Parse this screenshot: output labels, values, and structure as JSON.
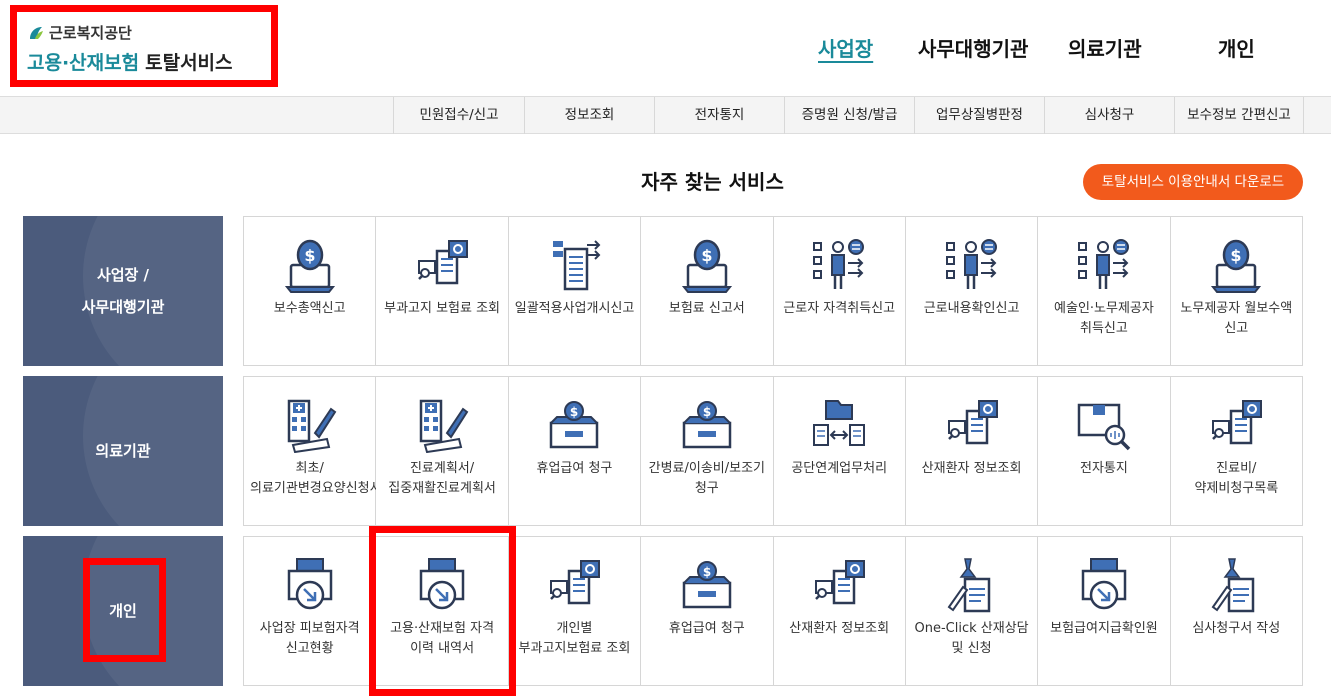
{
  "logo": {
    "org": "근로복지공단",
    "name_part1": "고용·산재보험",
    "name_part2": "토탈서비스"
  },
  "top_nav": [
    {
      "label": "사업장",
      "active": true
    },
    {
      "label": "사무대행기관",
      "active": false
    },
    {
      "label": "의료기관",
      "active": false
    },
    {
      "label": "개인",
      "active": false
    }
  ],
  "sub_nav": [
    {
      "label": "민원접수/신고"
    },
    {
      "label": "정보조회"
    },
    {
      "label": "전자통지"
    },
    {
      "label": "증명원 신청/발급"
    },
    {
      "label": "업무상질병판정"
    },
    {
      "label": "심사청구"
    },
    {
      "label": "보수정보 간편신고"
    }
  ],
  "section": {
    "title": "자주 찾는 서비스",
    "download_label": "토탈서비스 이용안내서 다운로드"
  },
  "rows": [
    {
      "category": "사업장 /\n사무대행기관",
      "tiles": [
        {
          "label": "보수총액신고",
          "icon": "money-laptop-icon"
        },
        {
          "label": "부과고지 보험료 조회",
          "icon": "document-search-icon"
        },
        {
          "label": "일괄적용사업개시신고",
          "icon": "document-transfer-icon"
        },
        {
          "label": "보험료 신고서",
          "icon": "money-laptop-icon"
        },
        {
          "label": "근로자 자격취득신고",
          "icon": "presenter-checklist-icon"
        },
        {
          "label": "근로내용확인신고",
          "icon": "presenter-checklist-icon"
        },
        {
          "label": "예술인·노무제공자 취득신고",
          "icon": "presenter-checklist-icon"
        },
        {
          "label": "노무제공자 월보수액 신고",
          "icon": "money-laptop-icon"
        }
      ]
    },
    {
      "category": "의료기관",
      "tiles": [
        {
          "label": "최초/의료기관변경요양신청서",
          "icon": "hospital-pen-icon"
        },
        {
          "label": "진료계획서/집중재활진료계획서",
          "icon": "hospital-pen-icon"
        },
        {
          "label": "휴업급여 청구",
          "icon": "money-box-icon"
        },
        {
          "label": "간병료/이송비/보조기 청구",
          "icon": "money-box-icon"
        },
        {
          "label": "공단연계업무처리",
          "icon": "folder-exchange-icon"
        },
        {
          "label": "산재환자 정보조회",
          "icon": "document-search-icon"
        },
        {
          "label": "전자통지",
          "icon": "box-magnifier-icon"
        },
        {
          "label": "진료비/약제비청구목록",
          "icon": "document-search-icon"
        }
      ]
    },
    {
      "category": "개인",
      "tiles": [
        {
          "label": "사업장 피보험자격 신고현황",
          "icon": "printer-download-icon"
        },
        {
          "label": "고용·산재보험 자격 이력 내역서",
          "icon": "printer-download-icon"
        },
        {
          "label": "개인별 부과고지보험료 조회",
          "icon": "document-search-icon"
        },
        {
          "label": "휴업급여 청구",
          "icon": "money-box-icon"
        },
        {
          "label": "산재환자 정보조회",
          "icon": "document-search-icon"
        },
        {
          "label": "One-Click 산재상담 및 신청",
          "icon": "pin-document-icon"
        },
        {
          "label": "보험급여지급확인원",
          "icon": "printer-download-icon"
        },
        {
          "label": "심사청구서 작성",
          "icon": "pin-document-icon"
        }
      ]
    }
  ],
  "colors": {
    "brand_teal": "#1a8a9a",
    "category_bg": "#4b5b7c",
    "accent_orange": "#f25a1c",
    "highlight_red": "#ff0000",
    "icon_blue": "#3f6fb5"
  }
}
